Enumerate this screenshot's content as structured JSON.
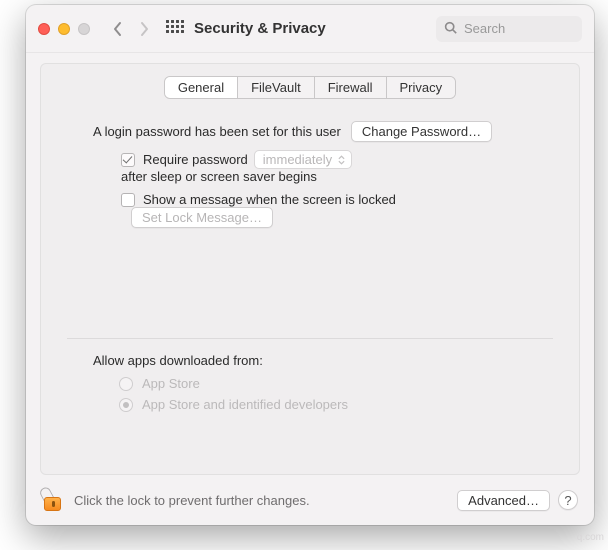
{
  "window": {
    "title": "Security & Privacy"
  },
  "search": {
    "placeholder": "Search"
  },
  "tabs": {
    "general": "General",
    "filevault": "FileVault",
    "firewall": "Firewall",
    "privacy": "Privacy"
  },
  "general": {
    "login_password_set": "A login password has been set for this user",
    "change_password_btn": "Change Password…",
    "require_password_label": "Require password",
    "require_password_delay": "immediately",
    "require_password_suffix": "after sleep or screen saver begins",
    "show_message_label": "Show a message when the screen is locked",
    "set_lock_message_btn": "Set Lock Message…"
  },
  "allow": {
    "title": "Allow apps downloaded from:",
    "option_appstore": "App Store",
    "option_appstore_dev": "App Store and identified developers"
  },
  "footer": {
    "lock_text": "Click the lock to prevent further changes.",
    "advanced_btn": "Advanced…",
    "help_label": "?"
  },
  "watermark": "q.com"
}
